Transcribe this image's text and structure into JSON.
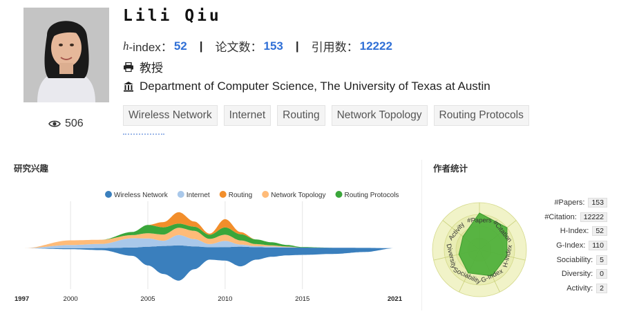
{
  "profile": {
    "name": "Lili Qiu",
    "hindex_label": "h",
    "hindex_suffix": "-index：",
    "hindex_value": "52",
    "papers_label": "论文数：",
    "papers_value": "153",
    "citations_label": "引用数：",
    "citations_value": "12222",
    "title": "教授",
    "affiliation": "Department of Computer Science, The University of Texas at Austin",
    "views": "506",
    "tags": [
      "Wireless Network",
      "Internet",
      "Routing",
      "Network Topology",
      "Routing Protocols"
    ]
  },
  "interests": {
    "title": "研究兴趣",
    "chart_data": {
      "type": "area",
      "x_ticks": [
        "1997",
        "2000",
        "2005",
        "2010",
        "2015",
        "2021"
      ],
      "xlim": [
        1997,
        2021
      ],
      "series": [
        {
          "name": "Wireless Network",
          "color": "#3a7fbd",
          "x": [
            1997,
            2000,
            2002,
            2004,
            2005,
            2006,
            2007,
            2008,
            2009,
            2010,
            2011,
            2012,
            2013,
            2014,
            2015,
            2017,
            2019,
            2021
          ],
          "values": [
            0,
            0.2,
            0.4,
            1.6,
            3.6,
            5.4,
            6.8,
            4.4,
            2.4,
            2.6,
            3.8,
            2.4,
            1.8,
            1.5,
            1.4,
            1.2,
            0.8,
            0
          ]
        },
        {
          "name": "Internet",
          "color": "#a9c8ea",
          "x": [
            1997,
            2000,
            2002,
            2004,
            2005,
            2006,
            2007,
            2008,
            2009,
            2010,
            2011,
            2012,
            2013,
            2014,
            2015,
            2017,
            2019,
            2021
          ],
          "values": [
            0,
            0.6,
            0.8,
            1.8,
            1.6,
            1.0,
            2.0,
            1.4,
            0.6,
            1.2,
            0.4,
            0.2,
            0.2,
            0.1,
            0,
            0,
            0,
            0
          ]
        },
        {
          "name": "Routing",
          "color": "#f28e2b",
          "x": [
            1997,
            2000,
            2002,
            2004,
            2005,
            2006,
            2007,
            2008,
            2009,
            2010,
            2011,
            2012,
            2013,
            2014,
            2015,
            2017,
            2019,
            2021
          ],
          "values": [
            0,
            0,
            0,
            0,
            0,
            1.0,
            2.2,
            1.0,
            0.2,
            1.6,
            0.4,
            0,
            0,
            0,
            0,
            0,
            0,
            0
          ]
        },
        {
          "name": "Network Topology",
          "color": "#ffbb78",
          "x": [
            1997,
            2000,
            2002,
            2004,
            2005,
            2006,
            2007,
            2008,
            2009,
            2010,
            2011,
            2012,
            2013,
            2014,
            2015,
            2017,
            2019,
            2021
          ],
          "values": [
            0,
            0.9,
            0.8,
            0.6,
            1.0,
            1.2,
            1.4,
            1.6,
            1.0,
            1.2,
            0.8,
            0.4,
            0.2,
            0.1,
            0,
            0,
            0,
            0
          ]
        },
        {
          "name": "Routing Protocols",
          "color": "#3aa63a",
          "x": [
            1997,
            2000,
            2002,
            2004,
            2005,
            2006,
            2007,
            2008,
            2009,
            2010,
            2011,
            2012,
            2013,
            2014,
            2015,
            2017,
            2019,
            2021
          ],
          "values": [
            0,
            0,
            0,
            0.6,
            1.6,
            1.4,
            0.8,
            0.8,
            0.8,
            1.4,
            1.2,
            0.9,
            0.6,
            0.3,
            0.1,
            0,
            0,
            0
          ]
        }
      ]
    }
  },
  "author_stats": {
    "title": "作者统计",
    "chart_data": {
      "type": "radar",
      "axes": [
        "#Papers",
        "#Citation",
        "H-Index",
        "G-Index",
        "Sociability",
        "Diversity",
        "Activity"
      ],
      "values": [
        0.78,
        0.75,
        0.6,
        0.62,
        0.55,
        0.45,
        0.45
      ],
      "fill": "#4caf3a"
    },
    "rows": [
      {
        "label": "#Papers:",
        "value": "153"
      },
      {
        "label": "#Citation:",
        "value": "12222"
      },
      {
        "label": "H-Index:",
        "value": "52"
      },
      {
        "label": "G-Index:",
        "value": "110"
      },
      {
        "label": "Sociability:",
        "value": "5"
      },
      {
        "label": "Diversity:",
        "value": "0"
      },
      {
        "label": "Activity:",
        "value": "2"
      }
    ]
  }
}
